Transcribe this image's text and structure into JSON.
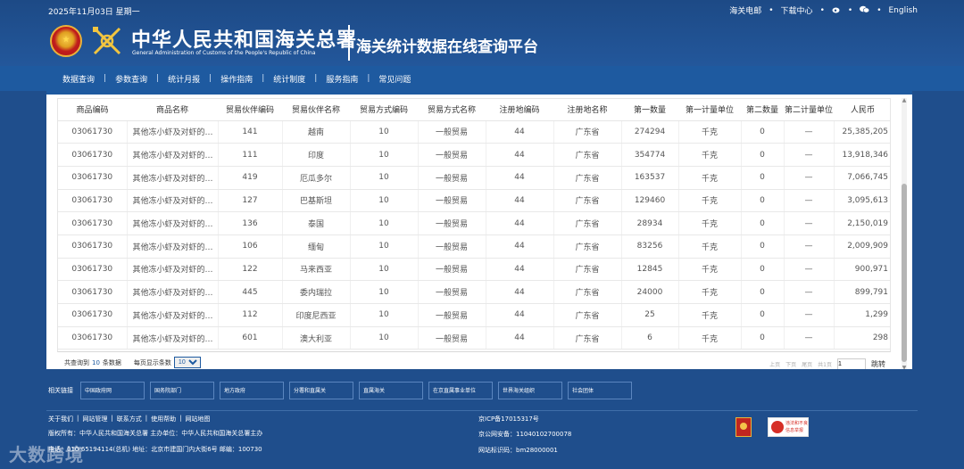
{
  "header": {
    "date": "2025年11月03日 星期一",
    "toplinks": [
      "海关电邮",
      "下载中心",
      "English"
    ],
    "title_cn": "中华人民共和国海关总署",
    "title_en": "General Administration of Customs of the People's Republic of China",
    "platform": "海关统计数据在线查询平台"
  },
  "nav": {
    "items": [
      "数据查询",
      "参数查询",
      "统计月报",
      "操作指南",
      "统计制度",
      "服务指南",
      "常见问题"
    ]
  },
  "table": {
    "columns": [
      "商品编码",
      "商品名称",
      "贸易伙伴编码",
      "贸易伙伴名称",
      "贸易方式编码",
      "贸易方式名称",
      "注册地编码",
      "注册地名称",
      "第一数量",
      "第一计量单位",
      "第二数量",
      "第二计量单位",
      "人民币"
    ],
    "rows": [
      [
        "03061730",
        "其他冻小虾及对虾的虾...",
        "141",
        "越南",
        "10",
        "一般贸易",
        "44",
        "广东省",
        "274294",
        "千克",
        "0",
        "—",
        "25,385,205"
      ],
      [
        "03061730",
        "其他冻小虾及对虾的虾...",
        "111",
        "印度",
        "10",
        "一般贸易",
        "44",
        "广东省",
        "354774",
        "千克",
        "0",
        "—",
        "13,918,346"
      ],
      [
        "03061730",
        "其他冻小虾及对虾的虾...",
        "419",
        "厄瓜多尔",
        "10",
        "一般贸易",
        "44",
        "广东省",
        "163537",
        "千克",
        "0",
        "—",
        "7,066,745"
      ],
      [
        "03061730",
        "其他冻小虾及对虾的虾...",
        "127",
        "巴基斯坦",
        "10",
        "一般贸易",
        "44",
        "广东省",
        "129460",
        "千克",
        "0",
        "—",
        "3,095,613"
      ],
      [
        "03061730",
        "其他冻小虾及对虾的虾...",
        "136",
        "泰国",
        "10",
        "一般贸易",
        "44",
        "广东省",
        "28934",
        "千克",
        "0",
        "—",
        "2,150,019"
      ],
      [
        "03061730",
        "其他冻小虾及对虾的虾...",
        "106",
        "缅甸",
        "10",
        "一般贸易",
        "44",
        "广东省",
        "83256",
        "千克",
        "0",
        "—",
        "2,009,909"
      ],
      [
        "03061730",
        "其他冻小虾及对虾的虾...",
        "122",
        "马来西亚",
        "10",
        "一般贸易",
        "44",
        "广东省",
        "12845",
        "千克",
        "0",
        "—",
        "900,971"
      ],
      [
        "03061730",
        "其他冻小虾及对虾的虾...",
        "445",
        "委内瑞拉",
        "10",
        "一般贸易",
        "44",
        "广东省",
        "24000",
        "千克",
        "0",
        "—",
        "899,791"
      ],
      [
        "03061730",
        "其他冻小虾及对虾的虾...",
        "112",
        "印度尼西亚",
        "10",
        "一般贸易",
        "44",
        "广东省",
        "25",
        "千克",
        "0",
        "—",
        "1,299"
      ],
      [
        "03061730",
        "其他冻小虾及对虾的虾...",
        "601",
        "澳大利亚",
        "10",
        "一般贸易",
        "44",
        "广东省",
        "6",
        "千克",
        "0",
        "—",
        "298"
      ]
    ]
  },
  "pager": {
    "total_prefix": "共查询到",
    "total_count": "10",
    "total_suffix": "条数据",
    "per_page_label": "每页显示条数",
    "per_page_value": "10",
    "first": "上页",
    "prev": "下页",
    "last": "尾页",
    "page_info": "共1页",
    "jump": "跳转"
  },
  "footer": {
    "links_label": "相关链接",
    "link_boxes": [
      "中国政府网",
      "国务院部门",
      "地方政府",
      "分署和直属关",
      "直属海关",
      "在京直属事业单位",
      "世界海关组织",
      "社会团体"
    ],
    "nav": [
      "关于我们",
      "网站管理",
      "联系方式",
      "使用帮助",
      "网站地图"
    ],
    "copyright": "版权所有：中华人民共和国海关总署  主办单位：中华人民共和国海关总署主办",
    "contact": "电话：010-65194114(总机)  地址：北京市建国门内大街6号  邮编：100730",
    "icp": "京ICP备17015317号",
    "public_security": "京公网安备：11040102700078",
    "site_code": "网站标识码：bm28000001",
    "report_text": "违法和不良信息举报",
    "watermark": "大数跨境"
  }
}
